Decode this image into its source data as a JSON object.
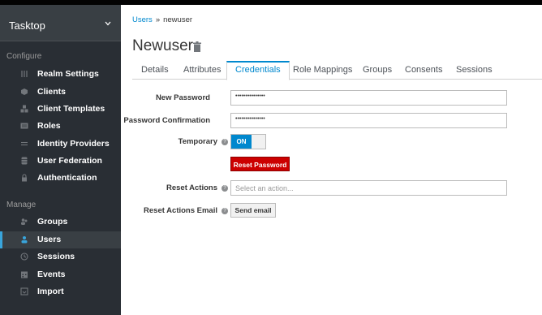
{
  "realm": {
    "name": "Tasktop"
  },
  "sidebar": {
    "configure_label": "Configure",
    "manage_label": "Manage",
    "configure_items": [
      {
        "label": "Realm Settings",
        "icon": "sliders-icon"
      },
      {
        "label": "Clients",
        "icon": "cube-icon"
      },
      {
        "label": "Client Templates",
        "icon": "cubes-icon"
      },
      {
        "label": "Roles",
        "icon": "roles-icon"
      },
      {
        "label": "Identity Providers",
        "icon": "exchange-icon"
      },
      {
        "label": "User Federation",
        "icon": "database-icon"
      },
      {
        "label": "Authentication",
        "icon": "lock-icon"
      }
    ],
    "manage_items": [
      {
        "label": "Groups",
        "icon": "users-icon"
      },
      {
        "label": "Users",
        "icon": "user-icon"
      },
      {
        "label": "Sessions",
        "icon": "clock-icon"
      },
      {
        "label": "Events",
        "icon": "calendar-icon"
      },
      {
        "label": "Import",
        "icon": "import-icon"
      }
    ]
  },
  "breadcrumb": {
    "root": "Users",
    "separator": "»",
    "current": "newuser"
  },
  "page": {
    "title": "Newuser"
  },
  "tabs": [
    "Details",
    "Attributes",
    "Credentials",
    "Role Mappings",
    "Groups",
    "Consents",
    "Sessions"
  ],
  "form": {
    "new_password_label": "New Password",
    "new_password_value": "•••••••••••••••",
    "confirm_label": "Password Confirmation",
    "confirm_value": "•••••••••••••••",
    "temporary_label": "Temporary",
    "temporary_toggle": "ON",
    "reset_password_button": "Reset Password",
    "reset_actions_label": "Reset Actions",
    "reset_actions_placeholder": "Select an action...",
    "reset_email_label": "Reset Actions Email",
    "send_email_button": "Send email"
  },
  "colors": {
    "accent": "#0088ce",
    "danger": "#cc0000",
    "sidebar": "#292e34"
  }
}
